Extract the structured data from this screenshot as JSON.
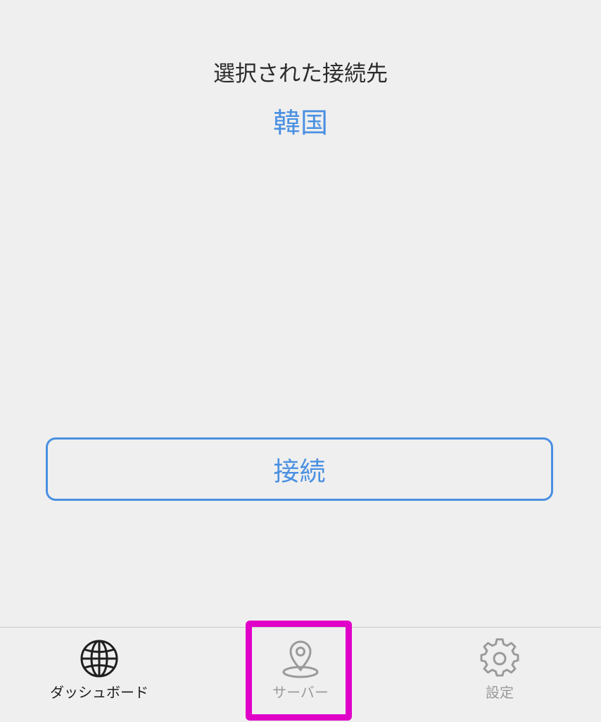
{
  "selection": {
    "label": "選択された接続先",
    "value": "韓国"
  },
  "connect_button": {
    "label": "接続"
  },
  "tab_bar": {
    "items": [
      {
        "id": "dashboard",
        "label": "ダッシュボード",
        "icon": "globe-icon",
        "active": true
      },
      {
        "id": "server",
        "label": "サーバー",
        "icon": "map-pin-icon",
        "active": false
      },
      {
        "id": "settings",
        "label": "設定",
        "icon": "gear-icon",
        "active": false
      }
    ]
  },
  "colors": {
    "accent": "#4a90e2",
    "active_tab": "#1f1f1f",
    "inactive_tab": "#9a9a9a",
    "highlight": "#e000c8"
  }
}
